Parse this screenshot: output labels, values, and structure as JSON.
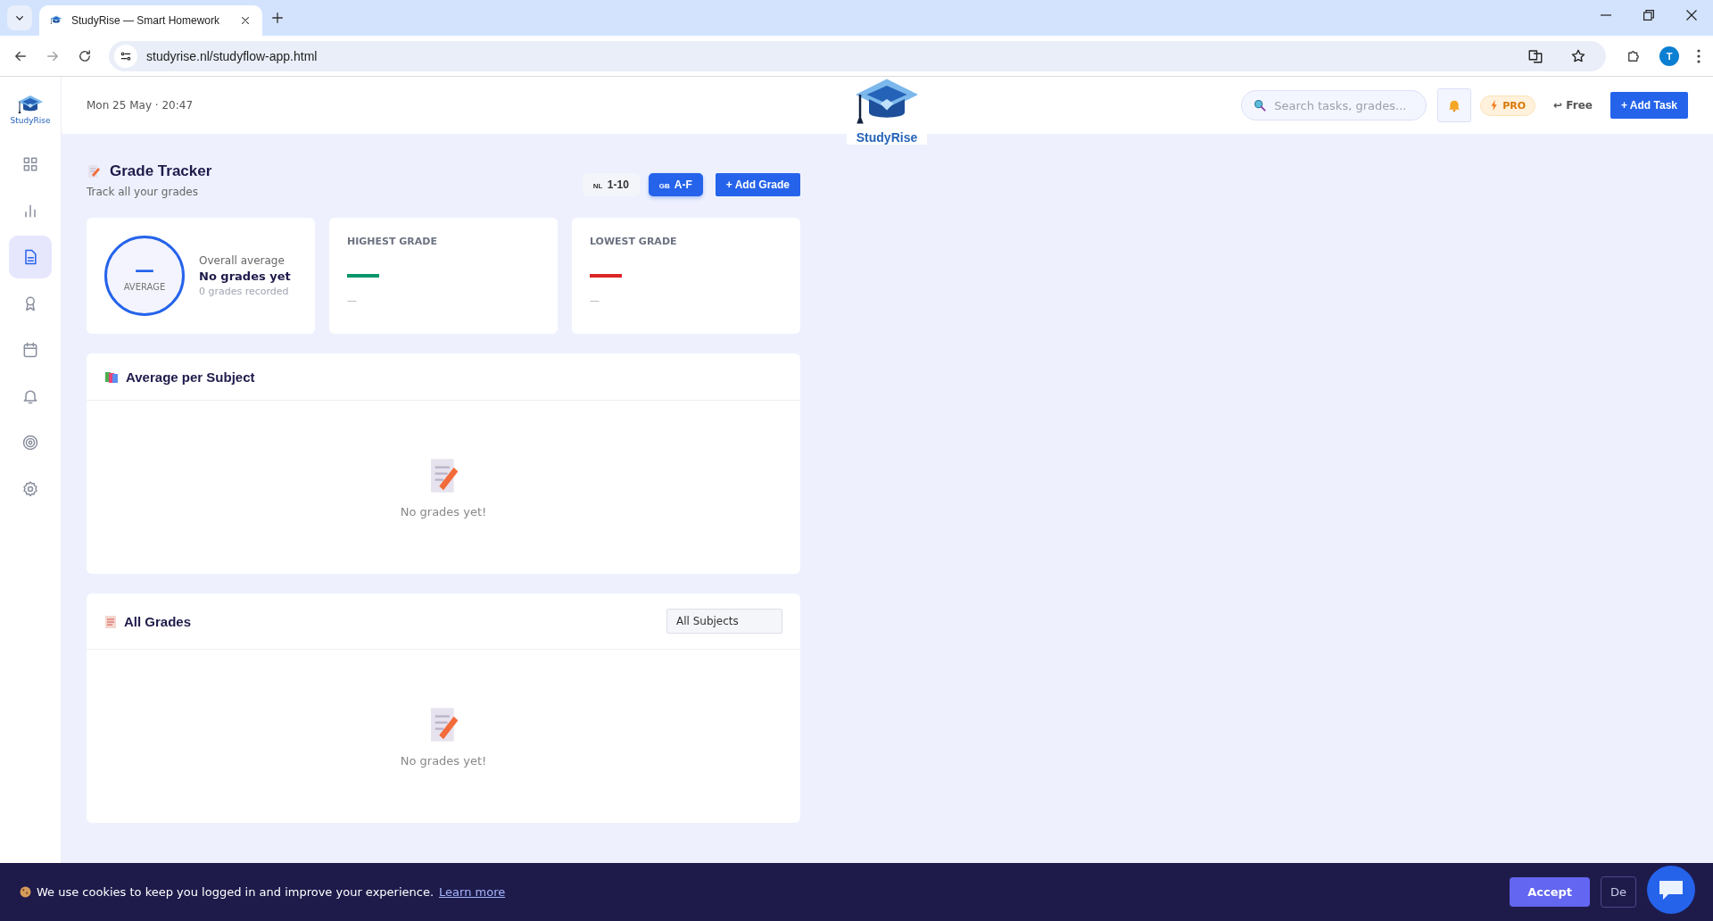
{
  "browser": {
    "tab_title": "StudyRise — Smart Homework",
    "url": "studyrise.nl/studyflow-app.html",
    "profile": "T"
  },
  "sidebar": {
    "logo_text": "StudyRise",
    "items": [
      {
        "selected": false
      },
      {
        "selected": false
      },
      {
        "selected": true
      },
      {
        "selected": false
      },
      {
        "selected": false
      },
      {
        "selected": false
      },
      {
        "selected": false
      },
      {
        "selected": false
      }
    ]
  },
  "header": {
    "datetime": "Mon 25 May · 20:47",
    "logo_text": "StudyRise",
    "search": {
      "placeholder": "Search tasks, grades..."
    },
    "pro_badge": "PRO",
    "free_link": "↩ Free",
    "add_task": "+ Add Task"
  },
  "page": {
    "title": "Grade Tracker",
    "subtitle": "Track all your grades",
    "scales": [
      {
        "flag": "NL",
        "label": "1-10",
        "selected": false
      },
      {
        "flag": "GB",
        "label": "A-F",
        "selected": true
      }
    ],
    "add_grade": "+ Add Grade",
    "average": {
      "value": "—",
      "caption": "AVERAGE",
      "label": "Overall average",
      "status": "No grades yet",
      "count": "0 grades recorded"
    },
    "stats": [
      {
        "title": "HIGHEST GRADE",
        "value": "—",
        "color": "#059669"
      },
      {
        "title": "LOWEST GRADE",
        "value": "—",
        "color": "#dc2626"
      }
    ],
    "panels": [
      {
        "title": "Average per Subject",
        "empty_text": "No grades yet!"
      },
      {
        "title": "All Grades",
        "filter": "All Subjects",
        "empty_text": "No grades yet!"
      }
    ]
  },
  "cookie_bar": {
    "text": "We use cookies to keep you logged in and improve your experience.",
    "link": "Learn more",
    "accept": "Accept",
    "decline": "De"
  }
}
